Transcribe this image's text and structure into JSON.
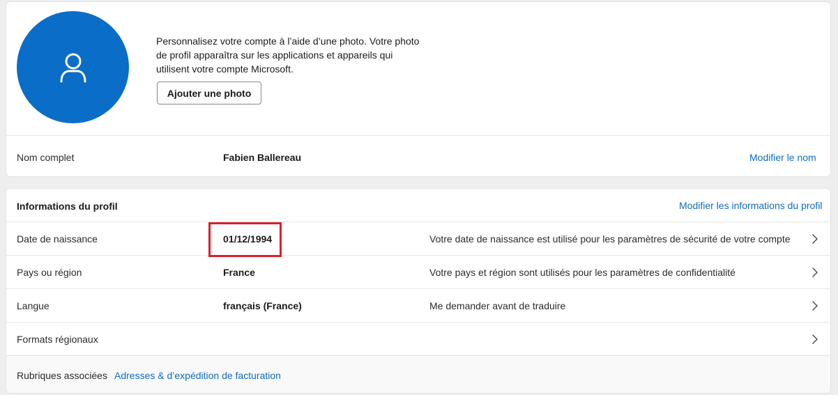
{
  "photo": {
    "description": "Personnalisez votre compte à l’aide d’une photo. Votre photo de profil apparaîtra sur les applications et appareils qui utilisent votre compte Microsoft.",
    "add_button": "Ajouter une photo",
    "avatar_icon": "person-icon",
    "avatar_color": "#0a6dc8"
  },
  "name_row": {
    "label": "Nom complet",
    "value": "Fabien Ballereau",
    "action": "Modifier le nom"
  },
  "profile_info": {
    "heading": "Informations du profil",
    "action": "Modifier les informations du profil",
    "rows": [
      {
        "label": "Date de naissance",
        "value": "01/12/1994",
        "description": "Votre date de naissance est utilisé pour les paramètres de sécurité de votre compte"
      },
      {
        "label": "Pays ou région",
        "value": "France",
        "description": "Votre pays et région sont utilisés pour les paramètres de confidentialité"
      },
      {
        "label": "Langue",
        "value": "français (France)",
        "description": "Me demander avant de traduire"
      },
      {
        "label": "Formats régionaux",
        "value": "",
        "description": ""
      }
    ],
    "related_label": "Rubriques associées",
    "related_link": "Adresses & d’expédition de facturation"
  },
  "colors": {
    "link": "#0f6cbd",
    "highlight_box": "#d9202a"
  }
}
